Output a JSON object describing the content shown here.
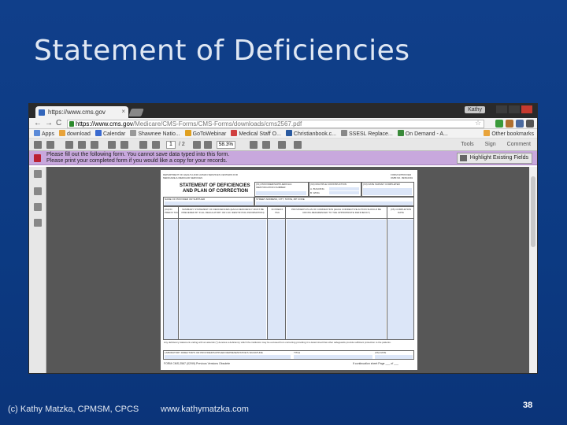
{
  "slide": {
    "title": "Statement of Deficiencies",
    "footer_author": "(c) Kathy Matzka, CPMSM, CPCS",
    "footer_url": "www.kathymatzka.com",
    "slide_number": "38"
  },
  "browser": {
    "tab_title": "https://www.cms.gov",
    "tab_close": "×",
    "user_label": "Kathy",
    "nav_glyphs": "←→C",
    "url_host": "https://www.cms.gov",
    "url_path": "/Medicare/CMS-Forms/CMS-Forms/downloads/cms2567.pdf",
    "star_glyph": "☆",
    "bookmarks": [
      "Apps",
      "download",
      "Calendar",
      "Shawnee Natio...",
      "GoToWebinar",
      "Medical Staff O...",
      "Christianbook.c...",
      "SSESL Replace...",
      "On Demand - A..."
    ],
    "other_bookmarks": "Other bookmarks",
    "colors": {
      "tabbar": "#2a2a2a",
      "banner": "#c8a8dd",
      "workspace": "#575757"
    }
  },
  "pdf_toolbar": {
    "page_current": "1",
    "page_total": "/ 2",
    "zoom": "58.3%",
    "tools": "Tools",
    "sign": "Sign",
    "comment": "Comment"
  },
  "banner": {
    "line1": "Please fill out the following form. You cannot save data typed into this form.",
    "line2": "Please print your completed form if you would like a copy for your records.",
    "highlight_button": "Highlight Existing Fields"
  },
  "form": {
    "agency": "DEPARTMENT OF HEALTH AND HUMAN SERVICES CENTERS FOR MEDICARE & MEDICAID SERVICES",
    "approved": "FORM APPROVED OMB NO. 0938-0391",
    "title_line1": "STATEMENT OF DEFICIENCIES",
    "title_line2": "AND PLAN OF CORRECTION",
    "provider_id": "(X1) PROVIDER/SUPPLIER/CLIA IDENTIFICATION NUMBER:",
    "multiple_construction": "(X2) MULTIPLE CONSTRUCTION",
    "building": "A. BUILDING",
    "wing": "B. WING",
    "date_survey": "(X3) DATE SURVEY COMPLETED",
    "provider_name": "NAME OF PROVIDER OR SUPPLIER",
    "street": "STREET ADDRESS, CITY, STATE, ZIP CODE",
    "col_id": "(X4) ID PREFIX TAG",
    "col_summary": "SUMMARY STATEMENT OF DEFICIENCIES (EACH DEFICIENCY MUST BE PRECEDED BY FULL REGULATORY OR LSC IDENTIFYING INFORMATION)",
    "col_id2": "ID PREFIX TAG",
    "col_plan": "PROVIDER'S PLAN OF CORRECTION (EACH CORRECTIVE ACTION SHOULD BE CROSS-REFERENCED TO THE APPROPRIATE DEFICIENCY)",
    "col_completion": "(X5) COMPLETION DATE",
    "disclaimer": "Any deficiency statement ending with an asterisk (*) denotes a deficiency which the institution may be excused from correcting providing it is determined that other safeguards provide sufficient protection to the patients.",
    "signature": "LABORATORY DIRECTOR'S OR PROVIDER/SUPPLIER REPRESENTATIVE'S SIGNATURE",
    "title_field": "TITLE",
    "x6_date": "(X6) DATE",
    "form_no": "FORM CMS-2567 (02/99) Previous Versions Obsolete",
    "continuation": "If continuation sheet Page ___ of ___"
  }
}
